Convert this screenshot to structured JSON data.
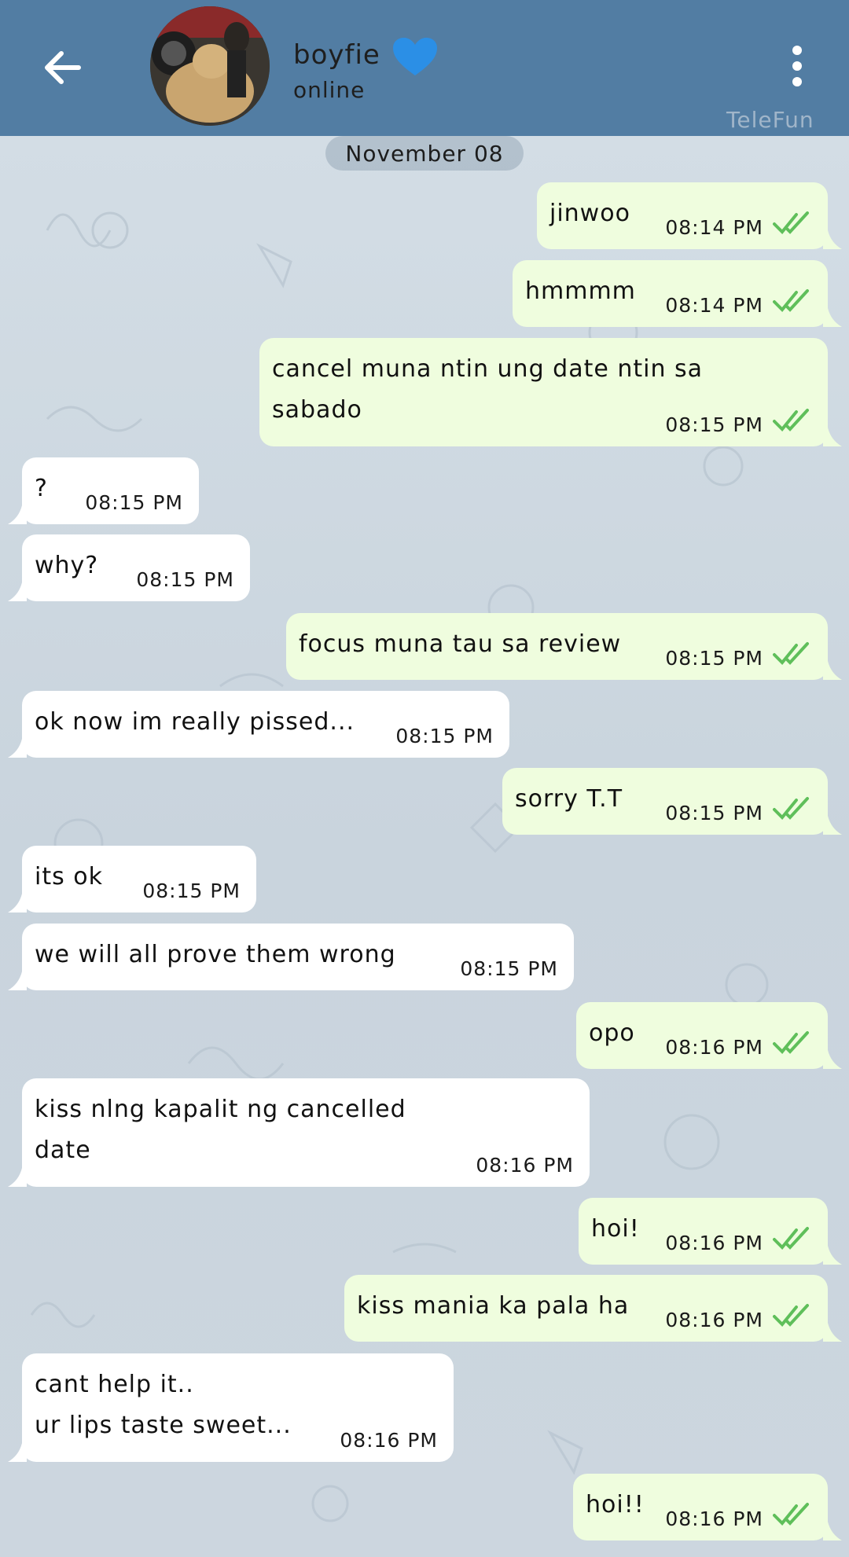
{
  "header": {
    "contact_name": "boyfie",
    "status": "online",
    "watermark": "TeleFun"
  },
  "date_separator": "November 08",
  "messages": [
    {
      "dir": "out",
      "text": "jinwoo",
      "time": "08:14 PM"
    },
    {
      "dir": "out",
      "text": "hmmmm",
      "time": "08:14 PM"
    },
    {
      "dir": "out",
      "text": "cancel muna ntin ung date ntin sa\nsabado",
      "time": "08:15 PM"
    },
    {
      "dir": "in",
      "text": "?",
      "time": "08:15 PM"
    },
    {
      "dir": "in",
      "text": "why?",
      "time": "08:15 PM"
    },
    {
      "dir": "out",
      "text": "focus muna tau sa review",
      "time": "08:15 PM"
    },
    {
      "dir": "in",
      "text": "ok now im really pissed...",
      "time": "08:15 PM"
    },
    {
      "dir": "out",
      "text": "sorry T.T",
      "time": "08:15 PM"
    },
    {
      "dir": "in",
      "text": "its ok",
      "time": "08:15 PM"
    },
    {
      "dir": "in",
      "text": "we will all prove them wrong",
      "time": "08:15 PM"
    },
    {
      "dir": "out",
      "text": "opo",
      "time": "08:16 PM"
    },
    {
      "dir": "in",
      "text": "kiss nlng kapalit ng cancelled\ndate",
      "time": "08:16 PM"
    },
    {
      "dir": "out",
      "text": "hoi!",
      "time": "08:16 PM"
    },
    {
      "dir": "out",
      "text": "kiss mania ka pala ha",
      "time": "08:16 PM"
    },
    {
      "dir": "in",
      "text": "cant help it..\nur lips taste sweet...",
      "time": "08:16 PM"
    },
    {
      "dir": "out",
      "text": "hoi!!",
      "time": "08:16 PM"
    }
  ],
  "colors": {
    "header": "#527da3",
    "outgoing_bubble": "#effdde",
    "incoming_bubble": "#ffffff",
    "read_ticks": "#5fbf5a"
  },
  "icons": [
    "back-arrow-icon",
    "blue-heart-icon",
    "more-vertical-icon",
    "double-check-icon"
  ]
}
